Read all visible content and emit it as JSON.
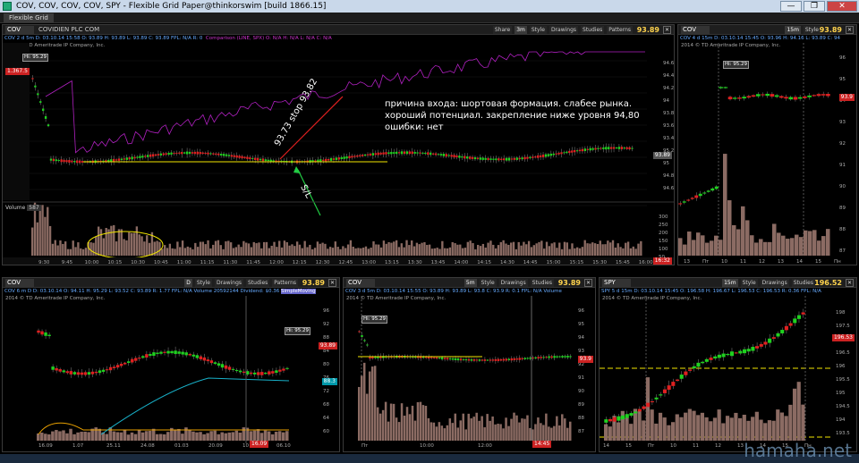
{
  "window": {
    "title": "COV, COV, COV, COV, SPY - Flexible Grid Paper@thinkorswim [build 1866.15]",
    "tab": "Flexible Grid",
    "minimize": "—",
    "maximize": "❐",
    "close": "✕"
  },
  "toolbar_labels": {
    "share": "Share",
    "style": "Style",
    "drawings": "Drawings",
    "studies": "Studies",
    "patterns": "Patterns"
  },
  "panels": {
    "main": {
      "symbol": "COV",
      "company": "COVIDIEN PLC COM",
      "timeframe": "3m",
      "last": "93.89",
      "info": "COV 2 d 5m  D: 03.10.14 15:58  O: 93.89  H: 93.89  L: 93.89  C: 93.89  FPL: N/A  R: 0",
      "comparison": "Comparison (LINE, SPX)  O: N/A  H: N/A  L: N/A  C: N/A",
      "copyright": "2014 © TD Ameritrade IP Company, Inc.",
      "price_tag": "93.89",
      "left_tag": "1.367.5",
      "hi_label": "Hi: 95.29",
      "y_ticks": [
        "94.6",
        "94.4",
        "94.2",
        "94",
        "93.8",
        "93.6",
        "93.4",
        "95.2",
        "95",
        "94.8",
        "94.6"
      ],
      "volume_label": "Volume",
      "volume_value": "587",
      "vol_ticks": [
        "300",
        "250",
        "200",
        "150",
        "100",
        "50"
      ],
      "x_ticks": [
        "9:30",
        "9:45",
        "10:00",
        "10:15",
        "10:30",
        "10:45",
        "11:00",
        "11:15",
        "11:30",
        "11:45",
        "12:00",
        "12:15",
        "12:30",
        "12:45",
        "13:00",
        "13:15",
        "13:30",
        "13:45",
        "14:00",
        "14:15",
        "14:30",
        "14:45",
        "15:00",
        "15:15",
        "15:30",
        "15:45",
        "16:00"
      ],
      "time_tag": "16:32"
    },
    "right_top": {
      "symbol": "COV",
      "timeframe": "15m",
      "last": "93.89",
      "info": "COV 4 d 15m  D: 03.10.14 15:45  O: 93.96  H: 94.16  L: 93.89  C: 94",
      "copyright": "2014 © TD Ameritrade IP Company, Inc.",
      "hi_label": "Hi: 95.29",
      "price_tag": "93.9",
      "y_ticks": [
        "96",
        "95",
        "94",
        "93",
        "92",
        "91",
        "90",
        "89",
        "88",
        "87"
      ],
      "x_ticks": [
        "13",
        "Пт",
        "10",
        "11",
        "12",
        "13",
        "14",
        "15",
        "Пн"
      ]
    },
    "bottom_left": {
      "symbol": "COV",
      "timeframe": "D",
      "last": "93.89",
      "info": "COV 6 m D  D: 03.10.14  O: 94.11  H: 95.29  L: 93.52  C: 93.89  R: 1.77  FPL: N/A  Volume 20592144  Dividend: $0.36",
      "study": "SimpleMoving",
      "copyright": "2014 © TD Ameritrade IP Company, Inc.",
      "hi_label": "Hi: 95.29",
      "price_tag": "93.89",
      "ma_tag": "88.3",
      "y_ticks": [
        "96",
        "92",
        "88",
        "84",
        "80",
        "76",
        "72",
        "68",
        "64",
        "60"
      ],
      "x_ticks": [
        "16.09",
        "1.07",
        "25.11",
        "24.08",
        "01.03",
        "20.09",
        "10",
        "06.10"
      ],
      "date_tag": "16.09"
    },
    "bottom_mid": {
      "symbol": "COV",
      "timeframe": "5m",
      "last": "93.89",
      "info": "COV 3 d 5m  D: 03.10.14 15:55  O: 93.89  H: 93.89  L: 93.8  C: 93.9  R: 0.1  FPL: N/A  Volume",
      "copyright": "2014 © TD Ameritrade IP Company, Inc.",
      "hi_label": "Hi: 95.29",
      "price_tag": "93.9",
      "y_ticks": [
        "96",
        "95",
        "94",
        "93",
        "92",
        "91",
        "90",
        "89",
        "88",
        "87"
      ],
      "x_ticks": [
        "Пт",
        "10:00",
        "12:00",
        "14:30"
      ],
      "time_tag": "14:45"
    },
    "bottom_right": {
      "symbol": "SPY",
      "timeframe": "15m",
      "last": "196.52",
      "info": "SPY 5 d 15m  D: 03.10.14 15:45  O: 196.58  H: 196.67  L: 196.53  C: 196.53  R: 0.36  FPL: N/A",
      "copyright": "2014 © TD Ameritrade IP Company, Inc.",
      "price_tag": "196.53",
      "y_ticks": [
        "198",
        "197.5",
        "197",
        "196.5",
        "196",
        "195.5",
        "195",
        "194.5",
        "194",
        "193.5"
      ],
      "x_ticks": [
        "14",
        "15",
        "Пт",
        "10",
        "11",
        "12",
        "13",
        "14",
        "15",
        "Пн"
      ]
    }
  },
  "annotations": {
    "line1": "причина входа: шортовая формация. слабее рынка.",
    "line2": "хороший потенциал. закрепление ниже уровня 94,80",
    "line3": "ошибки: нет",
    "stop": "93.73 stop 93.82",
    "sl": "S/L"
  },
  "watermark": "hamaha.net",
  "colors": {
    "up": "#1fd11f",
    "down": "#e02020",
    "comparison": "#b020c0",
    "level": "#f2e600",
    "last": "#ffd34d",
    "volume": "#8b6b63"
  }
}
